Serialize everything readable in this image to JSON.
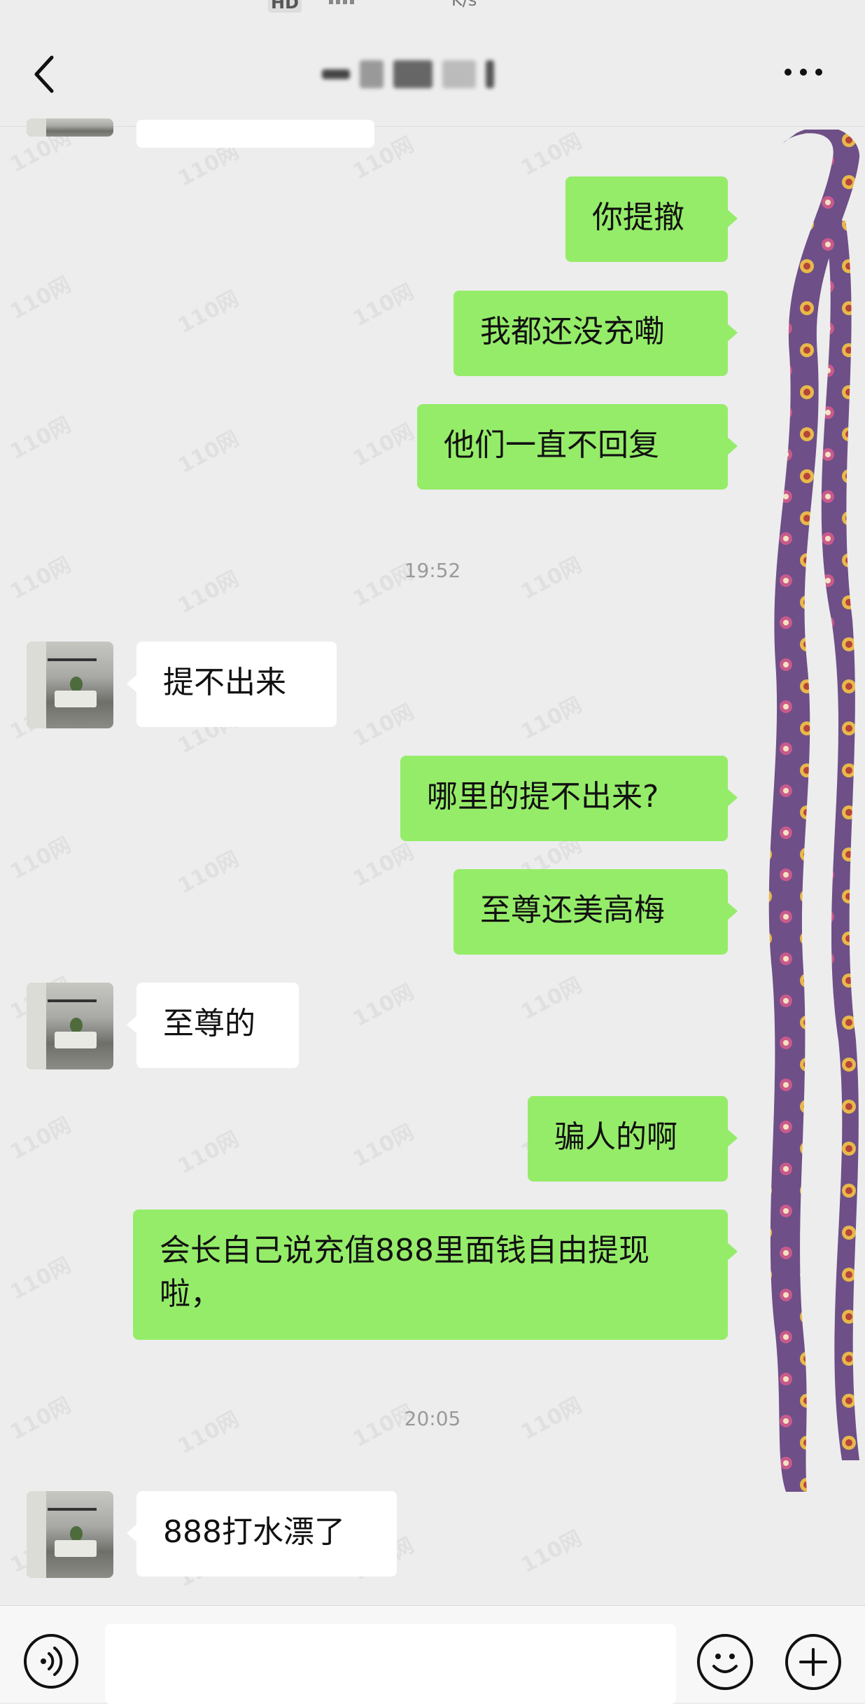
{
  "status_bar": {
    "hd_badge": "HD",
    "speed_unit": "K/s"
  },
  "header": {
    "back_icon": "chevron-left-icon",
    "more_icon": "ellipsis-icon"
  },
  "messages": [
    {
      "side": "left",
      "text": ""
    },
    {
      "side": "right",
      "text": "你提撤"
    },
    {
      "side": "right",
      "text": "我都还没充嘞"
    },
    {
      "side": "right",
      "text": "他们一直不回复"
    },
    {
      "side": "time",
      "text": "19:52"
    },
    {
      "side": "left",
      "text": "提不出来"
    },
    {
      "side": "right",
      "text": "哪里的提不出来?"
    },
    {
      "side": "right",
      "text": "至尊还美高梅"
    },
    {
      "side": "left",
      "text": "至尊的"
    },
    {
      "side": "right",
      "text": "骗人的啊"
    },
    {
      "side": "right",
      "text": "会长自己说充值888里面钱自由提现啦，"
    },
    {
      "side": "time",
      "text": "20:05"
    },
    {
      "side": "left",
      "text": "888打水漂了"
    }
  ],
  "watermark_text": "110网",
  "input_bar": {
    "voice_icon": "voice-icon",
    "emoji_icon": "emoji-icon",
    "plus_icon": "plus-icon"
  },
  "colors": {
    "background": "#ededed",
    "bubble_self": "#95ec69",
    "bubble_other": "#ffffff",
    "scribble": "#7b5a8f"
  }
}
